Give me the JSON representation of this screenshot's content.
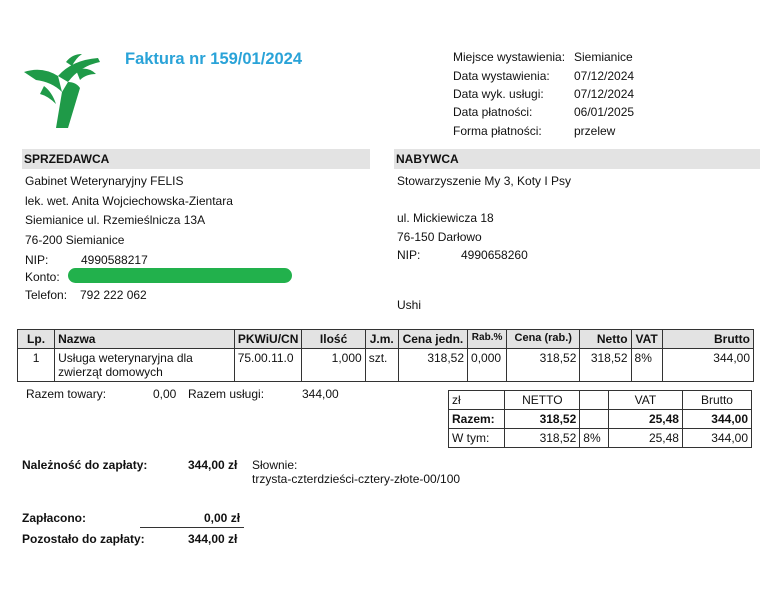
{
  "title": "Faktura nr 159/01/2024",
  "meta": [
    {
      "label": "Miejsce wystawienia:",
      "value": "Siemianice"
    },
    {
      "label": "Data wystawienia:",
      "value": "07/12/2024"
    },
    {
      "label": "Data wyk. usługi:",
      "value": "07/12/2024"
    },
    {
      "label": "Data płatności:",
      "value": "06/01/2025"
    },
    {
      "label": "Forma płatności:",
      "value": "przelew"
    }
  ],
  "seller": {
    "header": "SPRZEDAWCA",
    "name": "Gabinet Weterynaryjny FELIS",
    "person": "lek. wet. Anita Wojciechowska-Zientara",
    "address1": "Siemianice ul. Rzemieślnicza 13A",
    "address2": "76-200 Siemianice",
    "nip_label": "NIP:",
    "nip": "4990588217",
    "konto_label": "Konto:",
    "telefon_label": "Telefon:",
    "telefon": "792 222 062"
  },
  "buyer": {
    "header": "NABYWCA",
    "name": "Stowarzyszenie My 3, Koty I Psy",
    "address1": "ul. Mickiewicza 18",
    "address2": "76-150 Darłowo",
    "nip_label": "NIP:",
    "nip": "4990658260",
    "note": "Ushi"
  },
  "items_table": {
    "headers": [
      "Lp.",
      "Nazwa",
      "PKWiU/CN",
      "Ilość",
      "J.m.",
      "Cena jedn.",
      "Rab.%",
      "Cena (rab.)",
      "Netto",
      "VAT",
      "Brutto"
    ],
    "rows": [
      {
        "lp": "1",
        "nazwa": "Usługa weterynaryjna dla zwierząt domowych",
        "pkwiu": "75.00.11.0",
        "ilosc": "1,000",
        "jm": "szt.",
        "cena": "318,52",
        "rab": "0,000",
        "cena_rab": "318,52",
        "netto": "318,52",
        "vat": "8%",
        "brutto": "344,00"
      }
    ]
  },
  "totals_left": {
    "towary_label": "Razem towary:",
    "towary_value": "0,00",
    "uslugi_label": "Razem usługi:",
    "uslugi_value": "344,00"
  },
  "summary_table": {
    "header": [
      "zł",
      "NETTO",
      "",
      "VAT",
      "Brutto"
    ],
    "razem": [
      "Razem:",
      "318,52",
      "",
      "25,48",
      "344,00"
    ],
    "wtym": [
      "W tym:",
      "318,52",
      "8%",
      "25,48",
      "344,00"
    ]
  },
  "payment": {
    "naleznosc_label": "Należność do zapłaty:",
    "naleznosc_value": "344,00 zł",
    "slownie_label": "Słownie:",
    "slownie_value": "trzysta-czterdzieści-cztery-złote-00/100",
    "zaplacono_label": "Zapłacono:",
    "zaplacono_value": "0,00 zł",
    "pozostalo_label": "Pozostało do zapłaty:",
    "pozostalo_value": "344,00 zł"
  },
  "colors": {
    "title": "#2aa3d8",
    "logo": "#1f9a48",
    "redaction": "#22b14c",
    "section_bg": "#e3e3e3"
  },
  "logo_icon": "veterinary-logo-icon"
}
